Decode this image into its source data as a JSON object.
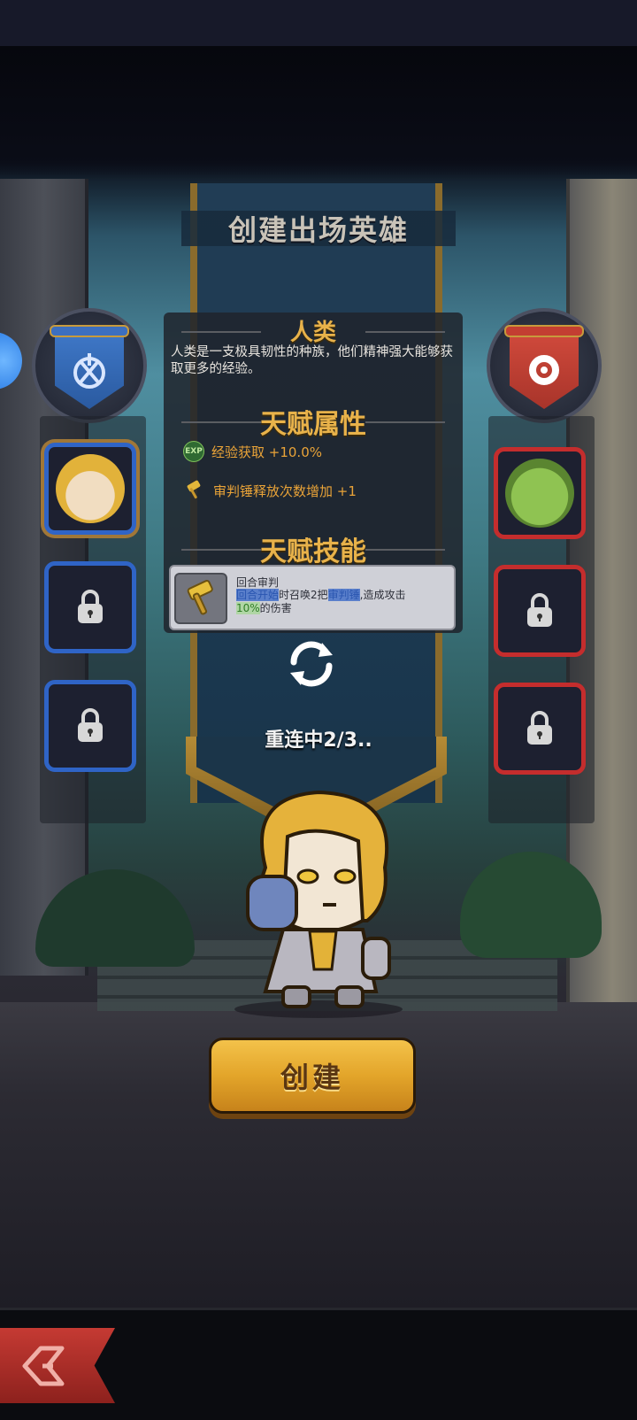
{
  "title": "创建出场英雄",
  "race": {
    "heading": "人类",
    "description": "人类是一支极具韧性的种族，他们精神强大能够获取更多的经验。"
  },
  "talent_attrs": {
    "heading": "天赋属性",
    "items": [
      {
        "icon": "exp-icon",
        "badge": "EXP",
        "text": "经验获取 +10.0%"
      },
      {
        "icon": "hammer-icon",
        "text": "审判锤释放次数增加 +1"
      }
    ]
  },
  "talent_skill": {
    "heading": "天赋技能",
    "name": "回合审判",
    "desc_1": "回合开始",
    "desc_2": "时召唤2把",
    "desc_3": "审判锤",
    "desc_4": ",造成攻击",
    "desc_5": "10%",
    "desc_6": "的伤害"
  },
  "status": "重连中2/3..",
  "create_button": "创建",
  "colors": {
    "human_blue": "#2f64c6",
    "orc_red": "#c42d2d",
    "gold": "#e8b24a"
  },
  "left_heroes": [
    {
      "state": "selected"
    },
    {
      "state": "locked"
    },
    {
      "state": "locked"
    }
  ],
  "right_heroes": [
    {
      "state": "unlocked"
    },
    {
      "state": "locked"
    },
    {
      "state": "locked"
    }
  ]
}
